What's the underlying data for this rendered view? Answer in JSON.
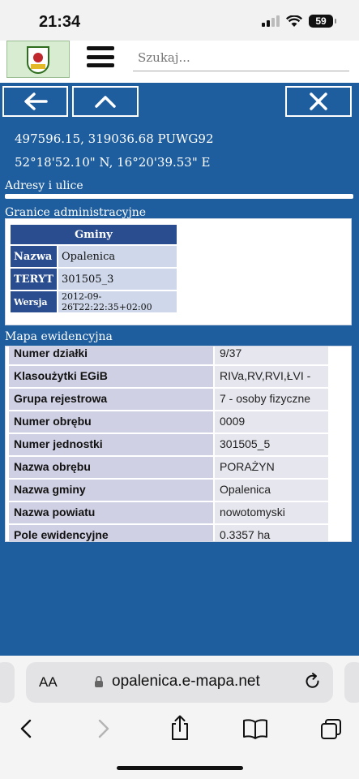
{
  "status_bar": {
    "time": "21:34",
    "battery": "59"
  },
  "header": {
    "search_placeholder": "Szukaj..."
  },
  "coordinates": {
    "puwg": "497596.15, 319036.68 PUWG92",
    "geo": "52°18'52.10\" N, 16°20'39.53\" E"
  },
  "sections": {
    "addresses_title": "Adresy i ulice",
    "admin_title": "Granice administracyjne",
    "parcel_title": "Mapa ewidencyjna"
  },
  "gminy": {
    "header": "Gminy",
    "rows": [
      {
        "key": "Nazwa",
        "value": "Opalenica"
      },
      {
        "key": "TERYT",
        "value": "301505_3"
      },
      {
        "key": "Wersja",
        "value": "2012-09-26T22:22:35+02:00"
      }
    ]
  },
  "parcel": {
    "rows": [
      {
        "key": "Numer działki",
        "value": "9/37"
      },
      {
        "key": "Klasoużytki EGiB",
        "value": "RIVa,RV,RVI,ŁVI -"
      },
      {
        "key": "Grupa rejestrowa",
        "value": "7 - osoby fizyczne"
      },
      {
        "key": "Numer obrębu",
        "value": "0009"
      },
      {
        "key": "Numer jednostki",
        "value": "301505_5"
      },
      {
        "key": "Nazwa obrębu",
        "value": "PORAŻYN"
      },
      {
        "key": "Nazwa gminy",
        "value": "Opalenica"
      },
      {
        "key": "Nazwa powiatu",
        "value": "nowotomyski"
      },
      {
        "key": "Pole ewidencyjne",
        "value": "0.3357 ha"
      }
    ]
  },
  "browser": {
    "aa_label": "AA",
    "url": "opalenica.e-mapa.net"
  }
}
